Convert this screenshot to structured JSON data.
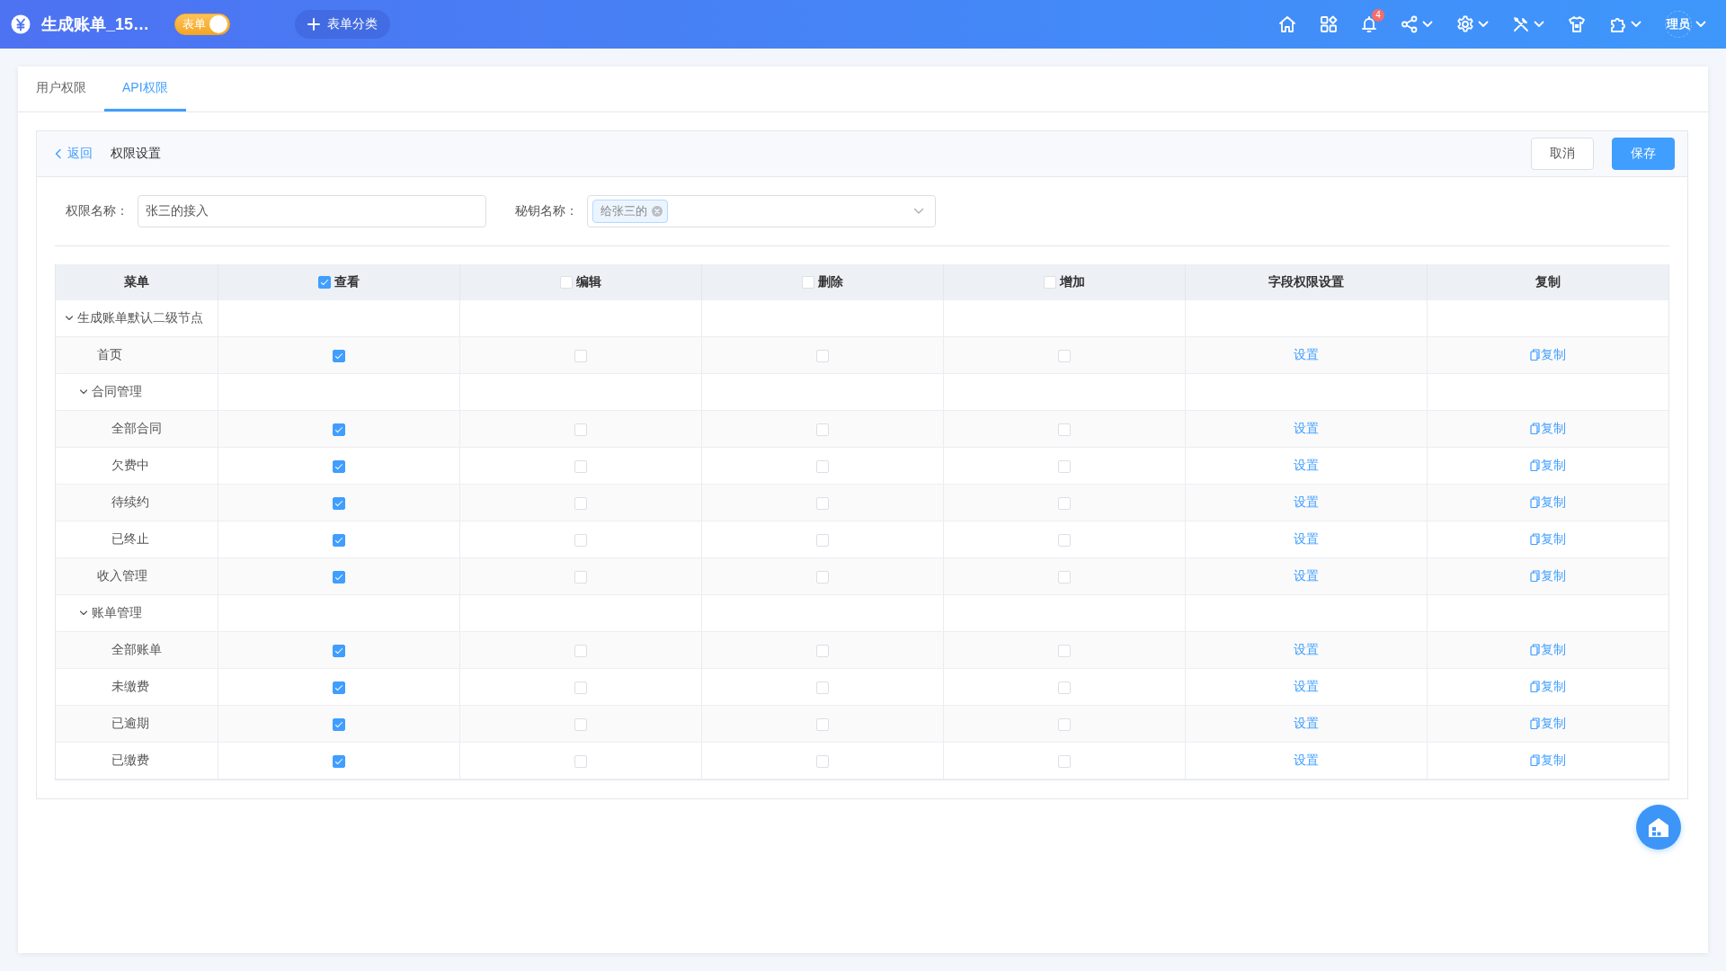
{
  "app": {
    "title": "生成账单_15…",
    "mode_toggle": {
      "label": "表单",
      "on": true
    },
    "category_button": "表单分类"
  },
  "toolbar": {
    "notification_count": "4",
    "user_label": "理员"
  },
  "tabs": [
    {
      "label": "用户权限",
      "selected": false
    },
    {
      "label": "API权限",
      "selected": true
    }
  ],
  "panel": {
    "back": "返回",
    "title": "权限设置",
    "buttons": [
      {
        "label": "取消",
        "kind": "default"
      },
      {
        "label": "保存",
        "kind": "primary"
      }
    ]
  },
  "form": {
    "name_label": "权限名称：",
    "name_value": "张三的接入",
    "key_label": "秘钥名称：",
    "key_tags": [
      "给张三的"
    ]
  },
  "table": {
    "columns": [
      {
        "label": "菜单",
        "kind": "text"
      },
      {
        "label": "查看",
        "kind": "check",
        "checked": true
      },
      {
        "label": "编辑",
        "kind": "check",
        "checked": false
      },
      {
        "label": "删除",
        "kind": "check",
        "checked": false
      },
      {
        "label": "增加",
        "kind": "check",
        "checked": false
      },
      {
        "label": "字段权限设置",
        "kind": "link"
      },
      {
        "label": "复制",
        "kind": "copy"
      }
    ],
    "rows": [
      {
        "name": "生成账单默认二级节点",
        "expanded": true,
        "children": [
          {
            "name": "首页",
            "checks": [
              true,
              false,
              false,
              false
            ],
            "field_setting": "设置",
            "copy": "复制"
          },
          {
            "name": "合同管理",
            "expanded": true,
            "children": [
              {
                "name": "全部合同",
                "checks": [
                  true,
                  false,
                  false,
                  false
                ],
                "field_setting": "设置",
                "copy": "复制"
              },
              {
                "name": "欠费中",
                "checks": [
                  true,
                  false,
                  false,
                  false
                ],
                "field_setting": "设置",
                "copy": "复制"
              },
              {
                "name": "待续约",
                "checks": [
                  true,
                  false,
                  false,
                  false
                ],
                "field_setting": "设置",
                "copy": "复制"
              },
              {
                "name": "已终止",
                "checks": [
                  true,
                  false,
                  false,
                  false
                ],
                "field_setting": "设置",
                "copy": "复制"
              }
            ]
          },
          {
            "name": "收入管理",
            "checks": [
              true,
              false,
              false,
              false
            ],
            "field_setting": "设置",
            "copy": "复制"
          },
          {
            "name": "账单管理",
            "expanded": true,
            "children": [
              {
                "name": "全部账单",
                "checks": [
                  true,
                  false,
                  false,
                  false
                ],
                "field_setting": "设置",
                "copy": "复制"
              },
              {
                "name": "未缴费",
                "checks": [
                  true,
                  false,
                  false,
                  false
                ],
                "field_setting": "设置",
                "copy": "复制"
              },
              {
                "name": "已逾期",
                "checks": [
                  true,
                  false,
                  false,
                  false
                ],
                "field_setting": "设置",
                "copy": "复制"
              },
              {
                "name": "已缴费",
                "checks": [
                  true,
                  false,
                  false,
                  false
                ],
                "field_setting": "设置",
                "copy": "复制"
              }
            ]
          }
        ]
      }
    ]
  }
}
